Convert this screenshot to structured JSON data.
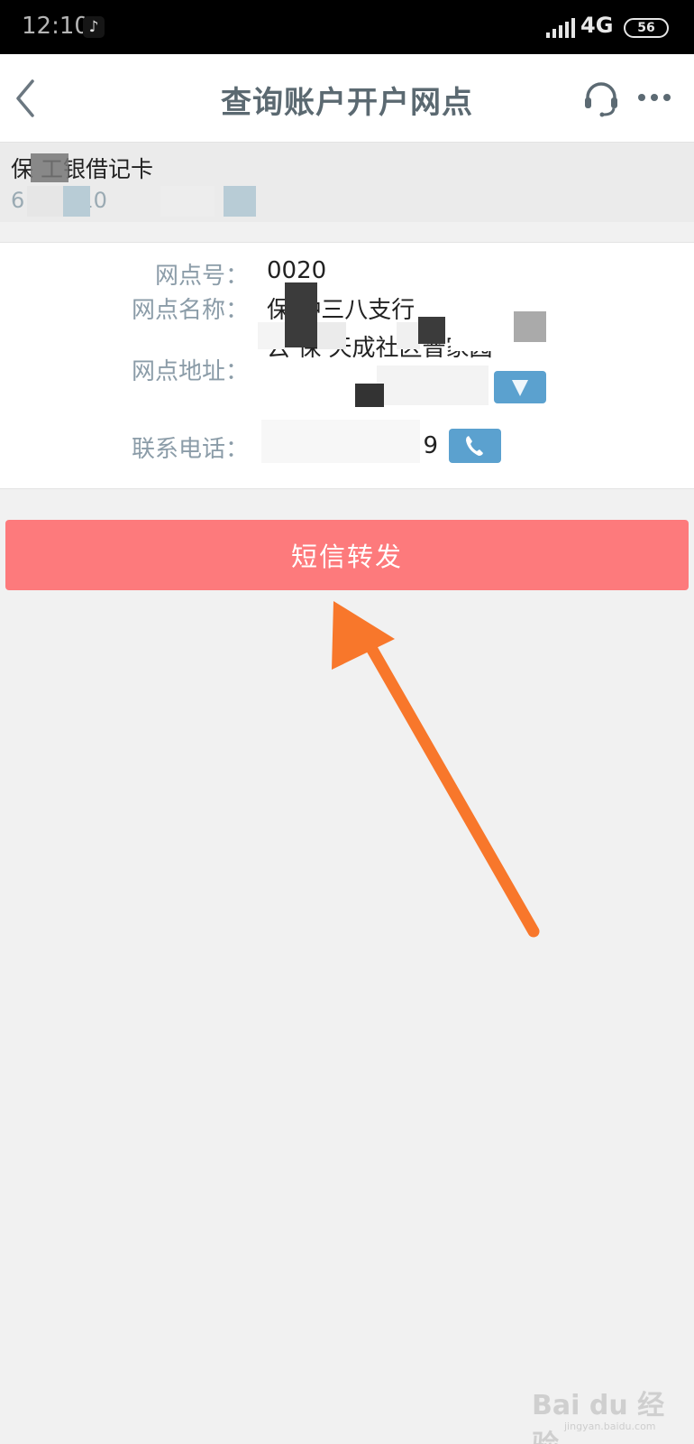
{
  "status_bar": {
    "time": "12:10",
    "network": "4G",
    "battery": "56"
  },
  "header": {
    "title": "查询账户开户网点"
  },
  "account": {
    "name_visible": "保 工银借记卡",
    "number_visible": "6 5 2510"
  },
  "branch": {
    "code_label": "网点号：",
    "code_value": "0020",
    "name_label": "网点名称：",
    "name_value": "保 冲三八支行",
    "address_label": "网点地址：",
    "address_value": "云 保 天成社区普家园",
    "phone_label": "联系电话：",
    "phone_value": "9"
  },
  "sms_button": {
    "label": "短信转发"
  },
  "watermark": {
    "logo": "Bai du 经验",
    "url": "jingyan.baidu.com"
  },
  "colors": {
    "accent_button": "#fd7a7c",
    "action_blue": "#5ba1cf",
    "arrow": "#f8772b",
    "label_gray": "#8b9ca8"
  },
  "icons": [
    "back-icon",
    "headset-icon",
    "more-icon",
    "location-icon",
    "phone-icon",
    "tiktok-icon",
    "signal-icon",
    "battery-icon"
  ]
}
